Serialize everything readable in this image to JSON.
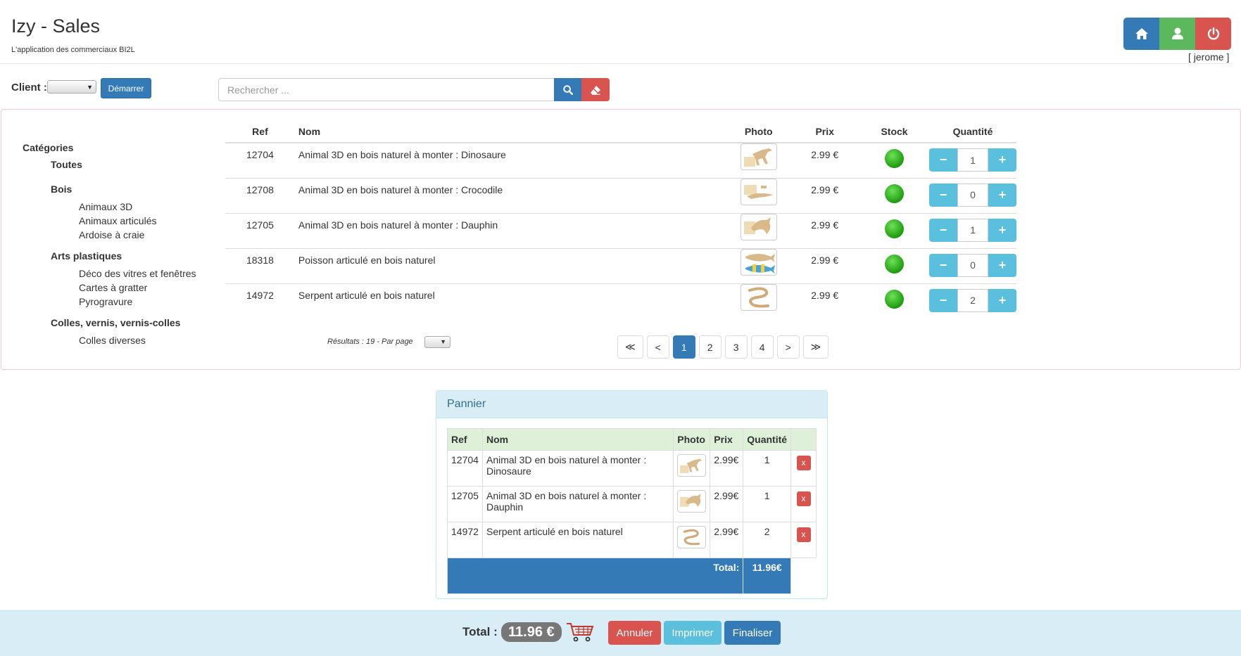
{
  "app": {
    "title": "Izy - Sales",
    "subtitle": "L'application des commerciaux BI2L",
    "username": "[ jerome ]"
  },
  "header_buttons": [
    {
      "icon": "home-icon"
    },
    {
      "icon": "user-icon"
    },
    {
      "icon": "power-icon"
    }
  ],
  "client": {
    "label": "Client :",
    "selected": "",
    "start_label": "Démarrer"
  },
  "search": {
    "placeholder": "Rechercher ...",
    "value": ""
  },
  "categories": {
    "title": "Catégories",
    "groups": [
      {
        "label": "Toutes",
        "items": []
      },
      {
        "label": "Bois",
        "items": [
          "Animaux 3D",
          "Animaux articulés",
          "Ardoise à craie"
        ]
      },
      {
        "label": "Arts plastiques",
        "items": [
          "Déco des vitres et fenêtres",
          "Cartes à gratter",
          "Pyrogravure"
        ]
      },
      {
        "label": "Colles, vernis, vernis-colles",
        "items": [
          "Colles diverses"
        ]
      }
    ]
  },
  "products": {
    "columns": [
      "Ref",
      "Nom",
      "Photo",
      "Prix",
      "Stock",
      "Quantité"
    ],
    "rows": [
      {
        "ref": "12704",
        "nom": "Animal 3D en bois naturel à monter : Dinosaure",
        "prix": "2.99 €",
        "stock": "in-stock",
        "qty": "1"
      },
      {
        "ref": "12708",
        "nom": "Animal 3D en bois naturel à monter : Crocodile",
        "prix": "2.99 €",
        "stock": "in-stock",
        "qty": "0"
      },
      {
        "ref": "12705",
        "nom": "Animal 3D en bois naturel à monter : Dauphin",
        "prix": "2.99 €",
        "stock": "in-stock",
        "qty": "1"
      },
      {
        "ref": "18318",
        "nom": "Poisson articulé en bois naturel",
        "prix": "2.99 €",
        "stock": "in-stock",
        "qty": "0"
      },
      {
        "ref": "14972",
        "nom": "Serpent articulé en bois naturel",
        "prix": "2.99 €",
        "stock": "in-stock",
        "qty": "2"
      }
    ],
    "results_text": "Résultats : 19 - Par page",
    "pagination": [
      "≪",
      "<",
      "1",
      "2",
      "3",
      "4",
      ">",
      "≫"
    ],
    "current_page": "1"
  },
  "cart": {
    "title": "Pannier",
    "columns": [
      "Ref",
      "Nom",
      "Photo",
      "Prix",
      "Quantité"
    ],
    "rows": [
      {
        "ref": "12704",
        "nom": "Animal 3D en bois naturel à monter : Dinosaure",
        "prix": "2.99€",
        "qty": "1"
      },
      {
        "ref": "12705",
        "nom": "Animal 3D en bois naturel à monter : Dauphin",
        "prix": "2.99€",
        "qty": "1"
      },
      {
        "ref": "14972",
        "nom": "Serpent articulé en bois naturel",
        "prix": "2.99€",
        "qty": "2"
      }
    ],
    "remove_label": "x",
    "total_label": "Total:",
    "total_value": "11.96€"
  },
  "footer": {
    "total_label": "Total :",
    "total_value": "11.96 €",
    "cancel_label": "Annuler",
    "print_label": "Imprimer",
    "finalize_label": "Finaliser"
  },
  "colors": {
    "primary": "#337ab7",
    "success": "#5cb85c",
    "danger": "#d9534f",
    "info": "#5bc0de"
  }
}
